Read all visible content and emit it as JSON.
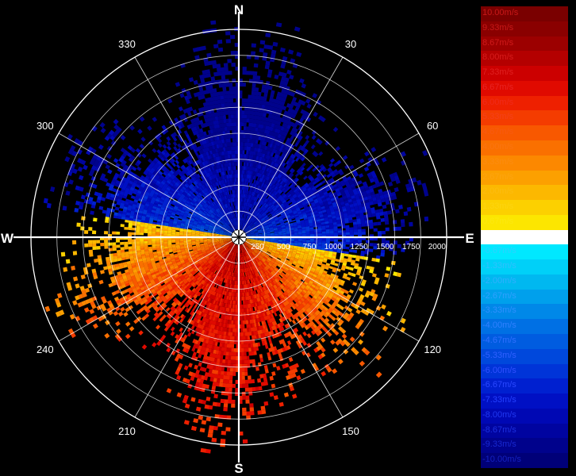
{
  "compass": {
    "north": "N",
    "south": "S",
    "east": "E",
    "west": "W"
  },
  "bearings": [
    {
      "deg": 30,
      "label": "30"
    },
    {
      "deg": 60,
      "label": "60"
    },
    {
      "deg": 120,
      "label": "120"
    },
    {
      "deg": 150,
      "label": "150"
    },
    {
      "deg": 210,
      "label": "210"
    },
    {
      "deg": 240,
      "label": "240"
    },
    {
      "deg": 300,
      "label": "300"
    },
    {
      "deg": 330,
      "label": "330"
    }
  ],
  "range_labels": [
    "250",
    "500",
    "750",
    "1000",
    "1250",
    "1500",
    "1750",
    "2000"
  ],
  "max_range": 2000,
  "legend": [
    {
      "label": "10.00m/s",
      "color": "#7a0000",
      "text_color": "#c81818"
    },
    {
      "label": "9.33m/s",
      "color": "#8a0000",
      "text_color": "#c81818"
    },
    {
      "label": "8.67m/s",
      "color": "#9c0000",
      "text_color": "#d01a1a"
    },
    {
      "label": "8.00m/s",
      "color": "#b40000",
      "text_color": "#d81c1c"
    },
    {
      "label": "7.33m/s",
      "color": "#cc0000",
      "text_color": "#e02020"
    },
    {
      "label": "6.67m/s",
      "color": "#e00a00",
      "text_color": "#e82424"
    },
    {
      "label": "6.00m/s",
      "color": "#ee2000",
      "text_color": "#f02a1a"
    },
    {
      "label": "5.33m/s",
      "color": "#f43c00",
      "text_color": "#f4401a"
    },
    {
      "label": "4.67m/s",
      "color": "#f85800",
      "text_color": "#f85a10"
    },
    {
      "label": "4.00m/s",
      "color": "#fa7000",
      "text_color": "#fa7410"
    },
    {
      "label": "3.33m/s",
      "color": "#fc8800",
      "text_color": "#fc8c10"
    },
    {
      "label": "2.67m/s",
      "color": "#fca000",
      "text_color": "#fca410"
    },
    {
      "label": "2.00m/s",
      "color": "#fcb800",
      "text_color": "#fcbc10"
    },
    {
      "label": "1.33m/s",
      "color": "#fcd000",
      "text_color": "#fcd410"
    },
    {
      "label": "0.67m/s",
      "color": "#fce600",
      "text_color": "#fce810"
    },
    {
      "label": "0.00m/s",
      "color": "#ffffff",
      "text_color": "#ffffff"
    },
    {
      "label": "-0.67m/s",
      "color": "#00e8ff",
      "text_color": "#30d0ff"
    },
    {
      "label": "-1.33m/s",
      "color": "#00d0f8",
      "text_color": "#30c0ff"
    },
    {
      "label": "-2.00m/s",
      "color": "#00b8f0",
      "text_color": "#30b0ff"
    },
    {
      "label": "-2.67m/s",
      "color": "#00a0ec",
      "text_color": "#30a0ff"
    },
    {
      "label": "-3.33m/s",
      "color": "#0088e8",
      "text_color": "#3090ff"
    },
    {
      "label": "-4.00m/s",
      "color": "#0070e4",
      "text_color": "#3080ff"
    },
    {
      "label": "-4.67m/s",
      "color": "#005ce0",
      "text_color": "#3070ff"
    },
    {
      "label": "-5.33m/s",
      "color": "#0048dc",
      "text_color": "#3060ff"
    },
    {
      "label": "-6.00m/s",
      "color": "#0034d8",
      "text_color": "#3050ff"
    },
    {
      "label": "-6.67m/s",
      "color": "#0020d0",
      "text_color": "#2a48ff"
    },
    {
      "label": "-7.33m/s",
      "color": "#0010c4",
      "text_color": "#2440ff"
    },
    {
      "label": "-8.00m/s",
      "color": "#0008b4",
      "text_color": "#2038f0"
    },
    {
      "label": "-8.67m/s",
      "color": "#0004a0",
      "text_color": "#1c30e0"
    },
    {
      "label": "-9.33m/s",
      "color": "#00028c",
      "text_color": "#1828d0"
    },
    {
      "label": "-10.00m/s",
      "color": "#000078",
      "text_color": "#1420c0"
    }
  ]
}
